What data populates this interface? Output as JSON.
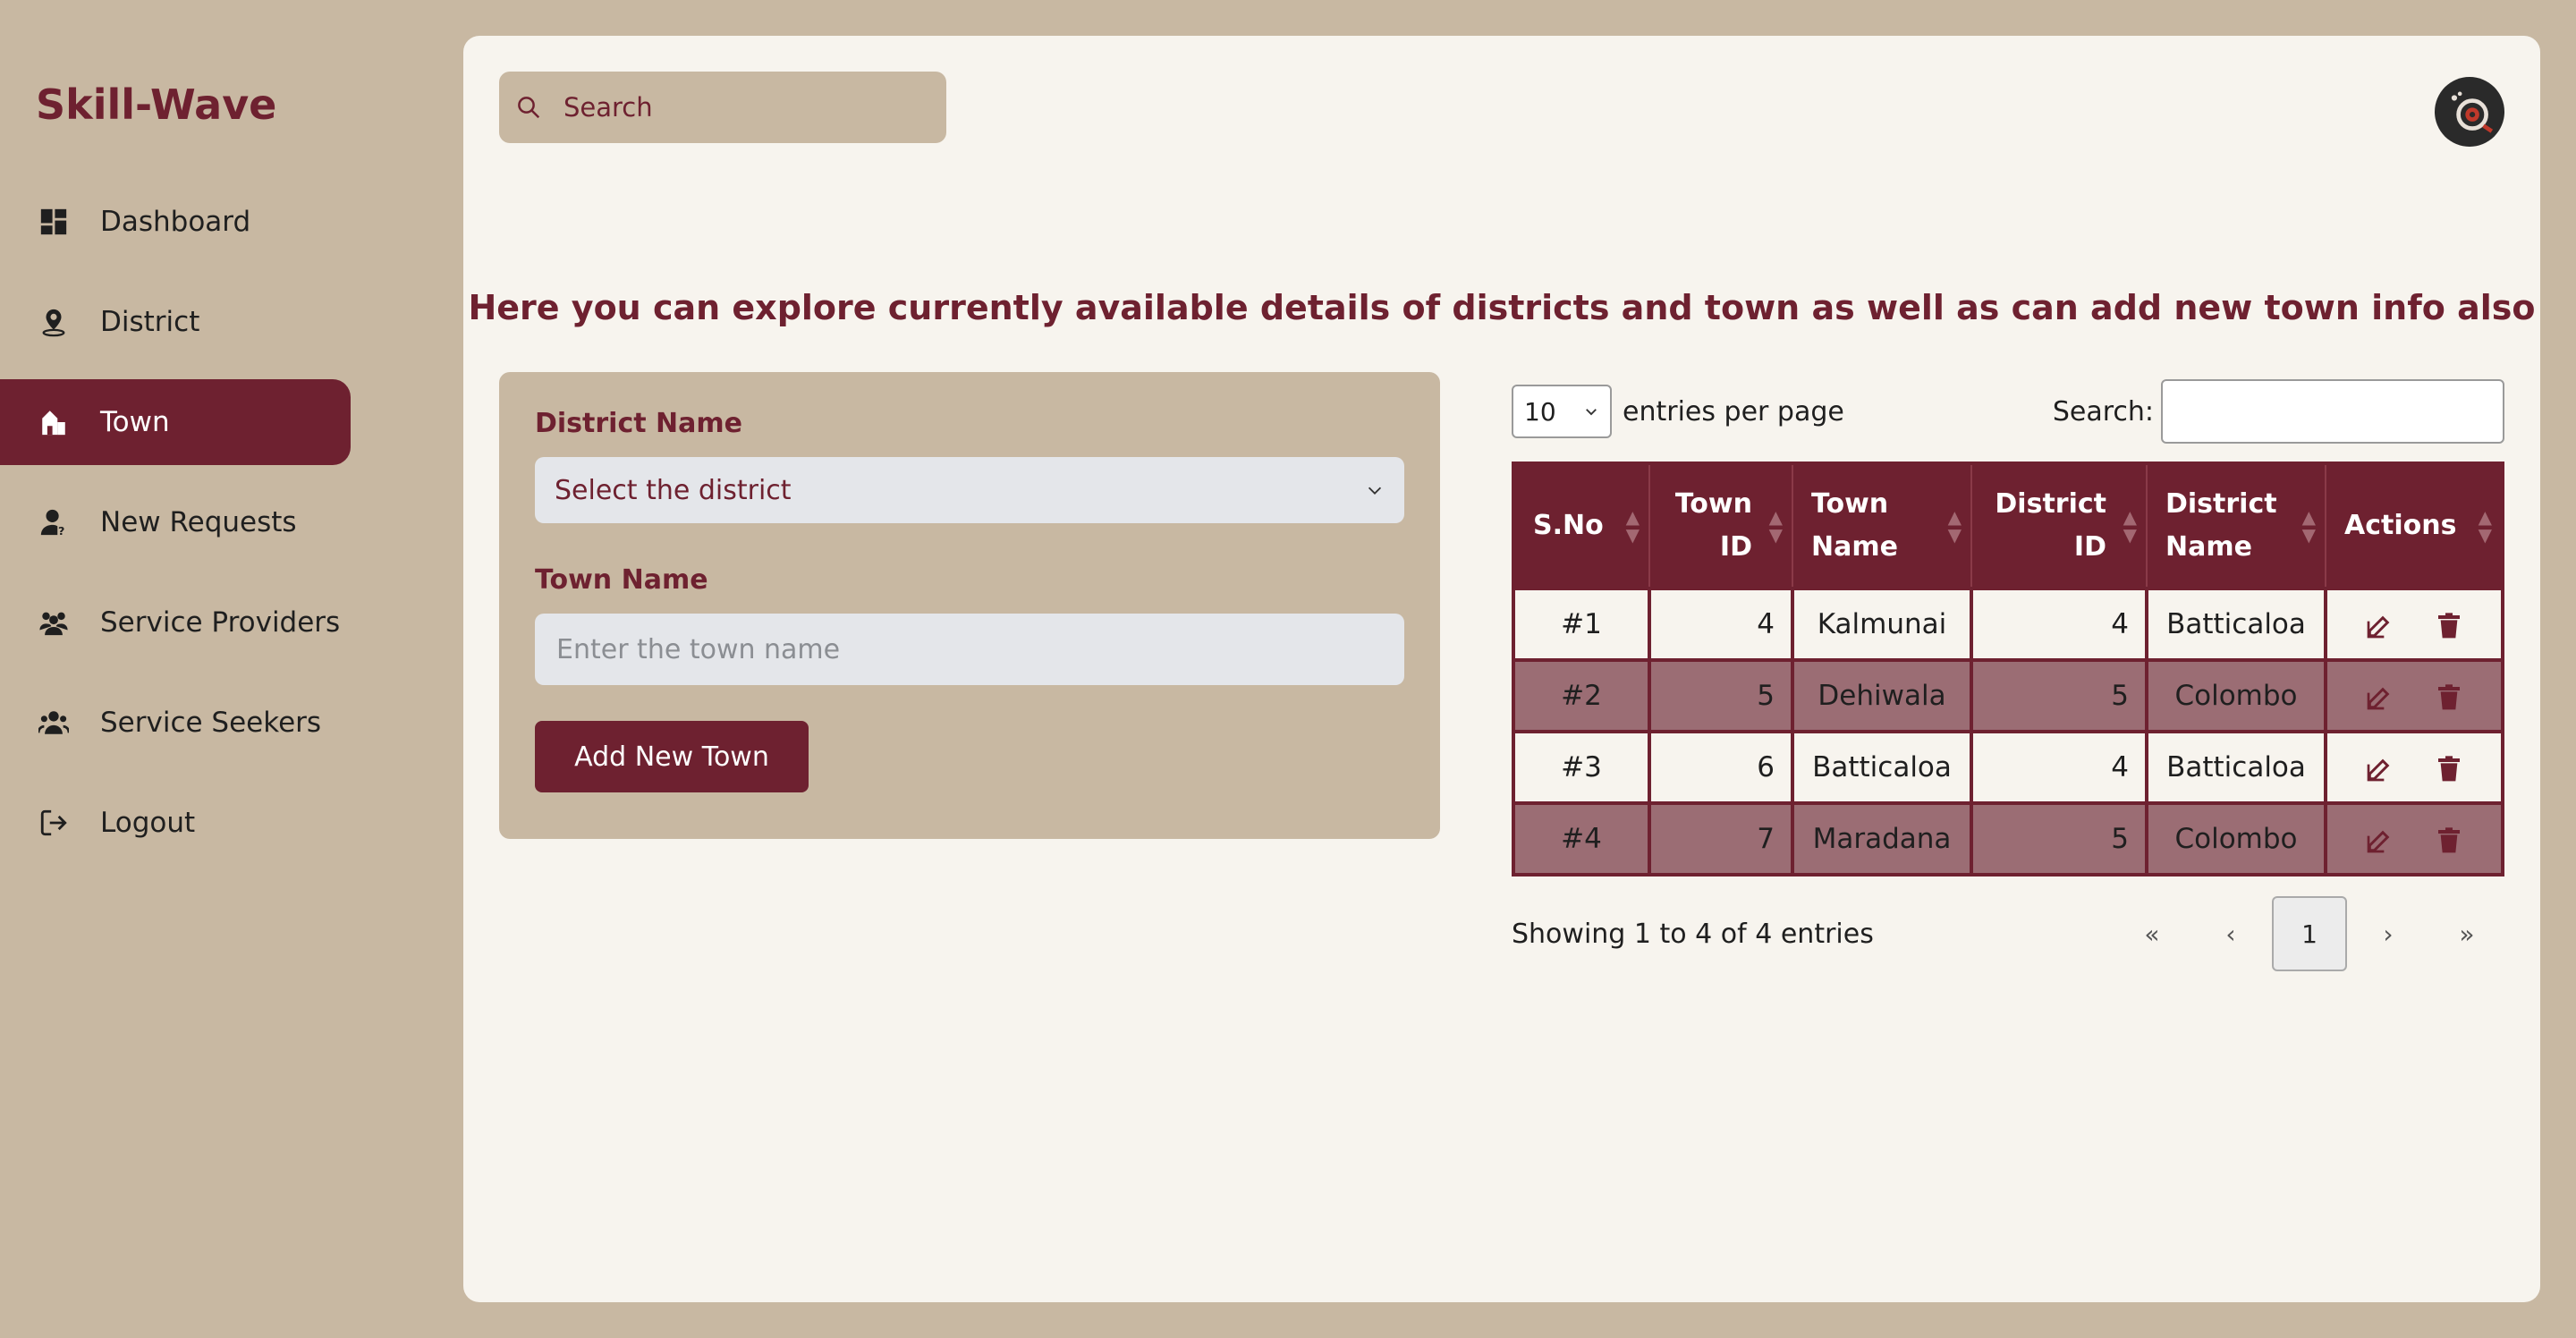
{
  "app": {
    "brand": "Skill-Wave"
  },
  "sidebar": {
    "items": [
      {
        "label": "Dashboard",
        "icon": "dashboard-icon",
        "active": false
      },
      {
        "label": "District",
        "icon": "map-pin-icon",
        "active": false
      },
      {
        "label": "Town",
        "icon": "town-icon",
        "active": true
      },
      {
        "label": "New Requests",
        "icon": "user-request-icon",
        "active": false
      },
      {
        "label": "Service Providers",
        "icon": "users-icon",
        "active": false
      },
      {
        "label": "Service Seekers",
        "icon": "user-group-icon",
        "active": false
      },
      {
        "label": "Logout",
        "icon": "logout-icon",
        "active": false
      }
    ]
  },
  "header": {
    "search_placeholder": "Search"
  },
  "headline": "Here you can explore currently available details of districts and town as well as can add new town info also",
  "form": {
    "district_label": "District Name",
    "district_select": "Select the district",
    "town_label": "Town Name",
    "town_placeholder": "Enter the town name",
    "submit_label": "Add New Town"
  },
  "table": {
    "per_page_value": "10",
    "per_page_label": "entries per page",
    "search_label": "Search:",
    "columns": [
      "S.No",
      "Town ID",
      "Town Name",
      "District ID",
      "District Name",
      "Actions"
    ],
    "rows": [
      {
        "sno": "#1",
        "town_id": "4",
        "town_name": "Kalmunai",
        "district_id": "4",
        "district_name": "Batticaloa"
      },
      {
        "sno": "#2",
        "town_id": "5",
        "town_name": "Dehiwala",
        "district_id": "5",
        "district_name": "Colombo"
      },
      {
        "sno": "#3",
        "town_id": "6",
        "town_name": "Batticaloa",
        "district_id": "4",
        "district_name": "Batticaloa"
      },
      {
        "sno": "#4",
        "town_id": "7",
        "town_name": "Maradana",
        "district_id": "5",
        "district_name": "Colombo"
      }
    ],
    "info": "Showing 1 to 4 of 4 entries",
    "pager": {
      "first": "«",
      "prev": "‹",
      "current": "1",
      "next": "›",
      "last": "»"
    }
  },
  "colors": {
    "accent": "#6e2130",
    "sidebar_bg": "#c8b8a2",
    "panel_bg": "#f7f4ee",
    "row_alt": "#9b6d74"
  }
}
